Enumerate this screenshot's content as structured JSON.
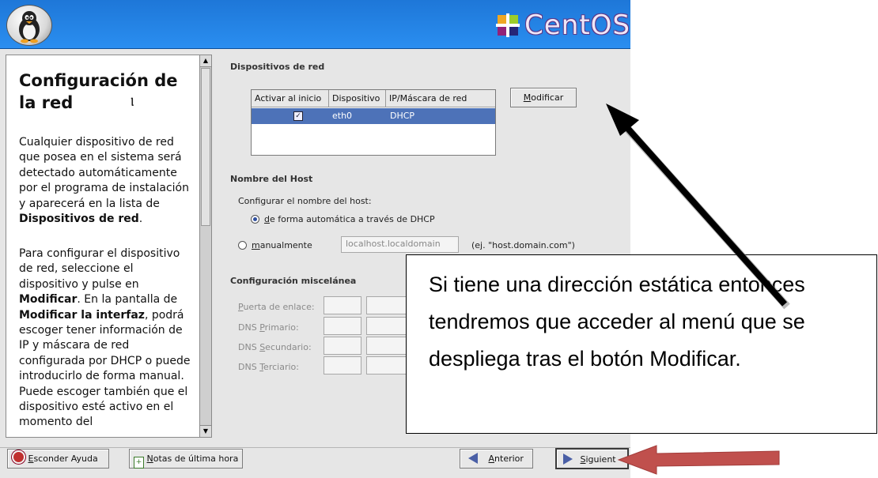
{
  "banner": {
    "brand": "CentOS",
    "brand_color": "#2a8ef0"
  },
  "help": {
    "title": "Configuración de la red",
    "paragraph1": "Cualquier dispositivo de red que posea en el sistema será detectado automáticamente por el programa de instalación y aparecerá en la lista de ",
    "paragraph1_bold": "Dispositivos de red",
    "paragraph1_end": ".",
    "p2_a": "Para configurar el dispositivo de red, seleccione el dispositivo y pulse en ",
    "p2_b": "Modificar",
    "p2_c": ". En la pantalla de ",
    "p2_d": "Modificar la interfaz",
    "p2_e": ", podrá escoger tener información de IP y máscara de red configurada por DHCP o puede introducirlo de forma manual. Puede escoger también que el dispositivo esté activo en el momento del"
  },
  "devices": {
    "section_label": "Dispositivos de red",
    "columns": [
      "Activar al inicio",
      "Dispositivo",
      "IP/Máscara de red"
    ],
    "rows": [
      {
        "active": true,
        "device": "eth0",
        "ip": "DHCP"
      }
    ],
    "modify_button": "Modificar",
    "modify_button_rest": "odificar",
    "modify_button_mnemonic": "M"
  },
  "hostname": {
    "section_label": "Nombre del Host",
    "configure_label": "Configurar el nombre del host:",
    "auto_option_mnemonic": "d",
    "auto_option_rest": "e forma automática a través de DHCP",
    "manual_option_mnemonic": "m",
    "manual_option_rest": "anualmente",
    "manual_value": "localhost.localdomain",
    "example": "(ej. \"host.domain.com\")",
    "selected": "auto"
  },
  "misc": {
    "section_label": "Configuración miscelánea",
    "fields": [
      {
        "mnemonic": "P",
        "rest": "uerta de enlace:"
      },
      {
        "prefix": "DNS ",
        "mnemonic": "P",
        "rest": "rimario:"
      },
      {
        "prefix": "DNS ",
        "mnemonic": "S",
        "rest": "ecundario:"
      },
      {
        "prefix": "DNS ",
        "mnemonic": "T",
        "rest": "erciario:"
      }
    ]
  },
  "callout": {
    "text": "Si tiene una dirección estática entonces tendremos que acceder al menú que se despliega tras el botón Modificar."
  },
  "bottom": {
    "hide_help_mnemonic": "E",
    "hide_help_rest": "sconder Ayuda",
    "release_notes_mnemonic": "N",
    "release_notes_rest": "otas de última hora",
    "back_mnemonic": "A",
    "back_rest": "nterior",
    "next_mnemonic": "S",
    "next_rest": "iguient"
  },
  "annotations": {
    "arrow_color_black": "#000000",
    "arrow_color_red": "#c0504d"
  }
}
